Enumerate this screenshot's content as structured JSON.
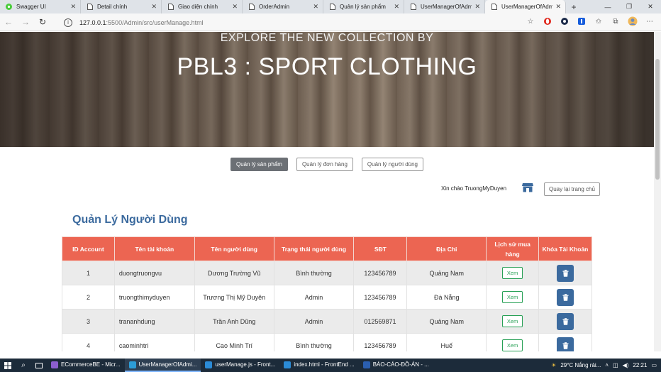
{
  "browser": {
    "tabs": [
      {
        "label": "Swagger UI",
        "icon": "swagger-icon",
        "color": "#49cc3a"
      },
      {
        "label": "Detail chính",
        "icon": "page-icon"
      },
      {
        "label": "Giao diện chính",
        "icon": "page-icon"
      },
      {
        "label": "OrderAdmin",
        "icon": "page-icon"
      },
      {
        "label": "Quản lý sản phẩm",
        "icon": "page-icon"
      },
      {
        "label": "UserManagerOfAdmin",
        "icon": "page-icon"
      },
      {
        "label": "UserManagerOfAdmin",
        "icon": "page-icon",
        "active": true
      }
    ],
    "url_host": "127.0.0.1",
    "url_path": ":5500/Admin/src/userManage.html"
  },
  "hero": {
    "subtitle": "EXPLORE THE NEW COLLECTION BY",
    "title": "PBL3 : SPORT CLOTHING"
  },
  "nav": {
    "products": "Quản lý sản phẩm",
    "orders": "Quản lý đơn hàng",
    "users": "Quản lý người dùng"
  },
  "user": {
    "greeting": "Xin chào TruongMyDuyen",
    "back_home": "Quay lại trang chủ"
  },
  "page_heading": "Quản Lý Người Dùng",
  "table": {
    "headers": [
      "ID Account",
      "Tên tài khoản",
      "Tên người dùng",
      "Trạng thái người dùng",
      "SĐT",
      "Địa Chỉ",
      "Lịch sử mua hàng",
      "Khóa Tài Khoản"
    ],
    "view_label": "Xem",
    "rows": [
      {
        "id": "1",
        "username": "duongtruongvu",
        "name": "Dương Trường Vũ",
        "status": "Bình thường",
        "phone": "123456789",
        "address": "Quảng Nam"
      },
      {
        "id": "2",
        "username": "truongthimyduyen",
        "name": "Trương Thị Mỹ Duyên",
        "status": "Admin",
        "phone": "123456789",
        "address": "Đà Nẵng"
      },
      {
        "id": "3",
        "username": "trananhdung",
        "name": "Trần Anh Dũng",
        "status": "Admin",
        "phone": "012569871",
        "address": "Quảng Nam"
      },
      {
        "id": "4",
        "username": "caominhtri",
        "name": "Cao Minh Trí",
        "status": "Bình thường",
        "phone": "123456789",
        "address": "Huế"
      }
    ]
  },
  "taskbar": {
    "items": [
      {
        "label": "ECommerceBE - Micr...",
        "color": "#8c5fd0"
      },
      {
        "label": "UserManagerOfAdmi...",
        "color": "#2c9cd6",
        "active": true
      },
      {
        "label": "userManage.js - Front...",
        "color": "#2b8bd6"
      },
      {
        "label": "index.html - FrontEnd ...",
        "color": "#2b8bd6"
      },
      {
        "label": "BÁO-CÁO-ĐỒ-ÁN - ...",
        "color": "#2b5fb0"
      }
    ],
    "weather": "29°C  Nắng rải...",
    "time": "22:21"
  }
}
